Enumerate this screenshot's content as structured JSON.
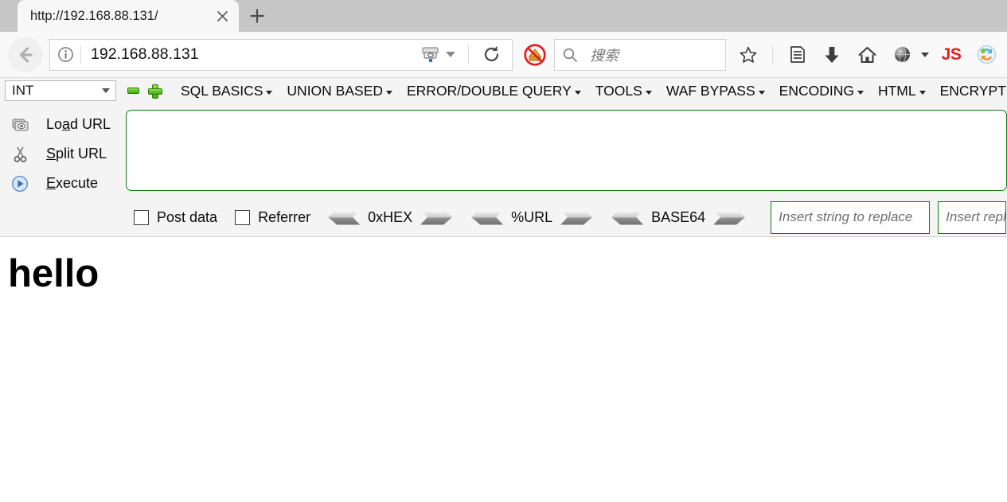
{
  "browser": {
    "tab": {
      "title": "http://192.168.88.131/",
      "close_icon": "close-icon",
      "new_tab_icon": "plus-icon"
    },
    "nav": {
      "back_icon": "back-arrow-icon",
      "info_icon": "info-circle-icon",
      "url_value": "192.168.88.131",
      "proxy_icon": "proxy-server-icon",
      "proxy_caret_icon": "chevron-down-icon",
      "reload_icon": "reload-icon",
      "noscript_blocked_icon": "script-blocked-icon"
    },
    "search": {
      "icon": "search-icon",
      "placeholder": "搜索"
    },
    "toolbar_icons": [
      {
        "name": "bookmark-star-icon",
        "glyph": "★"
      },
      {
        "name": "library-icon",
        "glyph": "▤"
      },
      {
        "name": "downloads-icon",
        "glyph": "⬇"
      },
      {
        "name": "home-icon",
        "glyph": "⌂"
      },
      {
        "name": "noscript-globe-icon",
        "glyph": "●"
      },
      {
        "name": "noscript-caret-icon",
        "glyph": "▾"
      },
      {
        "name": "javascript-toggle-icon",
        "label": "JS"
      },
      {
        "name": "hackbar-icon",
        "glyph": "◐"
      }
    ]
  },
  "hackbar": {
    "type_select": {
      "value": "INT",
      "caret_icon": "chevron-down-icon"
    },
    "minus_button": "remove-tab-button",
    "plus_button": "add-tab-button",
    "menu": [
      {
        "label": "SQL BASICS"
      },
      {
        "label": "UNION BASED"
      },
      {
        "label": "ERROR/DOUBLE QUERY"
      },
      {
        "label": "TOOLS"
      },
      {
        "label": "WAF BYPASS"
      },
      {
        "label": "ENCODING"
      },
      {
        "label": "HTML"
      },
      {
        "label": "ENCRYPTION"
      }
    ],
    "actions": [
      {
        "label_pre": "Lo",
        "accesskey": "a",
        "label_post": "d URL",
        "icon": "load-url-icon"
      },
      {
        "label_pre": "",
        "accesskey": "S",
        "label_post": "plit URL",
        "icon": "split-url-icon"
      },
      {
        "label_pre": "",
        "accesskey": "E",
        "label_post": "xecute",
        "icon": "execute-icon"
      }
    ],
    "textarea_value": "",
    "options": {
      "post_data_label": "Post data",
      "post_data_checked": false,
      "referrer_label": "Referrer",
      "referrer_checked": false
    },
    "encoders": [
      {
        "label": "0xHEX"
      },
      {
        "label": "%URL"
      },
      {
        "label": "BASE64"
      }
    ],
    "replace_from_placeholder": "Insert string to replace",
    "replace_to_placeholder": "Insert replacement string",
    "border_color": "#117d11"
  },
  "page": {
    "heading": "hello"
  }
}
